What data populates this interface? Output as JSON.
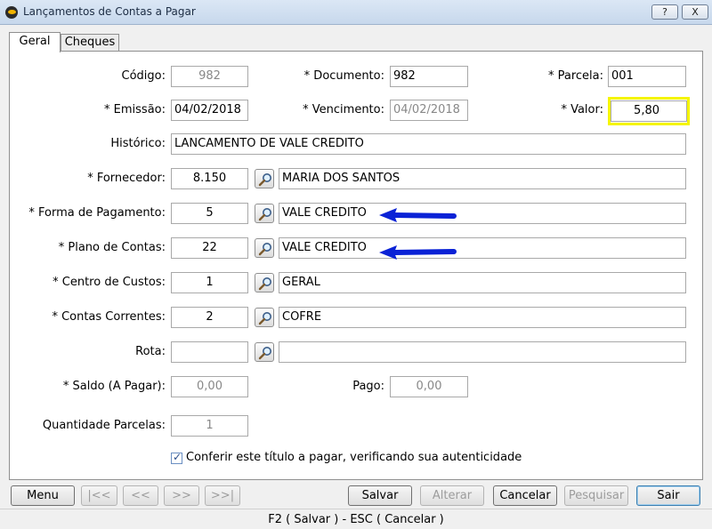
{
  "window": {
    "title": "Lançamentos de Contas a Pagar",
    "help": "?",
    "close": "X"
  },
  "tabs": {
    "geral": "Geral",
    "cheques": "Cheques"
  },
  "form": {
    "codigo": {
      "label": "Código:",
      "value": "982"
    },
    "documento": {
      "label": "* Documento:",
      "value": "982"
    },
    "parcela": {
      "label": "* Parcela:",
      "value": "001"
    },
    "emissao": {
      "label": "* Emissão:",
      "value": "04/02/2018"
    },
    "vencimento": {
      "label": "* Vencimento:",
      "value": "04/02/2018"
    },
    "valor": {
      "label": "* Valor:",
      "value": "5,80"
    },
    "historico": {
      "label": "Histórico:",
      "value": "LANCAMENTO DE VALE CREDITO"
    },
    "fornecedor": {
      "label": "* Fornecedor:",
      "code": "8.150",
      "name": "MARIA DOS SANTOS"
    },
    "forma_pagamento": {
      "label": "* Forma de Pagamento:",
      "code": "5",
      "name": "VALE CREDITO"
    },
    "plano_contas": {
      "label": "* Plano de Contas:",
      "code": "22",
      "name": "VALE CREDITO"
    },
    "centro_custos": {
      "label": "* Centro de Custos:",
      "code": "1",
      "name": "GERAL"
    },
    "contas_correntes": {
      "label": "* Contas Correntes:",
      "code": "2",
      "name": "COFRE"
    },
    "rota": {
      "label": "Rota:",
      "code": "",
      "name": ""
    },
    "saldo": {
      "label": "* Saldo (A Pagar):",
      "value": "0,00"
    },
    "pago": {
      "label": "Pago:",
      "value": "0,00"
    },
    "quantidade_parcelas": {
      "label": "Quantidade Parcelas:",
      "value": "1"
    },
    "conferir": {
      "label": "Conferir este título a pagar, verificando sua autenticidade",
      "checked": true
    }
  },
  "buttons": {
    "menu": "Menu",
    "first": "|<<",
    "prev": "<<",
    "next": ">>",
    "last": ">>|",
    "salvar": "Salvar",
    "alterar": "Alterar",
    "cancelar": "Cancelar",
    "pesquisar": "Pesquisar",
    "sair": "Sair"
  },
  "status": "F2 ( Salvar )  -  ESC ( Cancelar )",
  "colors": {
    "highlight": "#f5f500",
    "arrow": "#0a22d6"
  },
  "icons": {
    "lookup": "magnifier-icon"
  }
}
